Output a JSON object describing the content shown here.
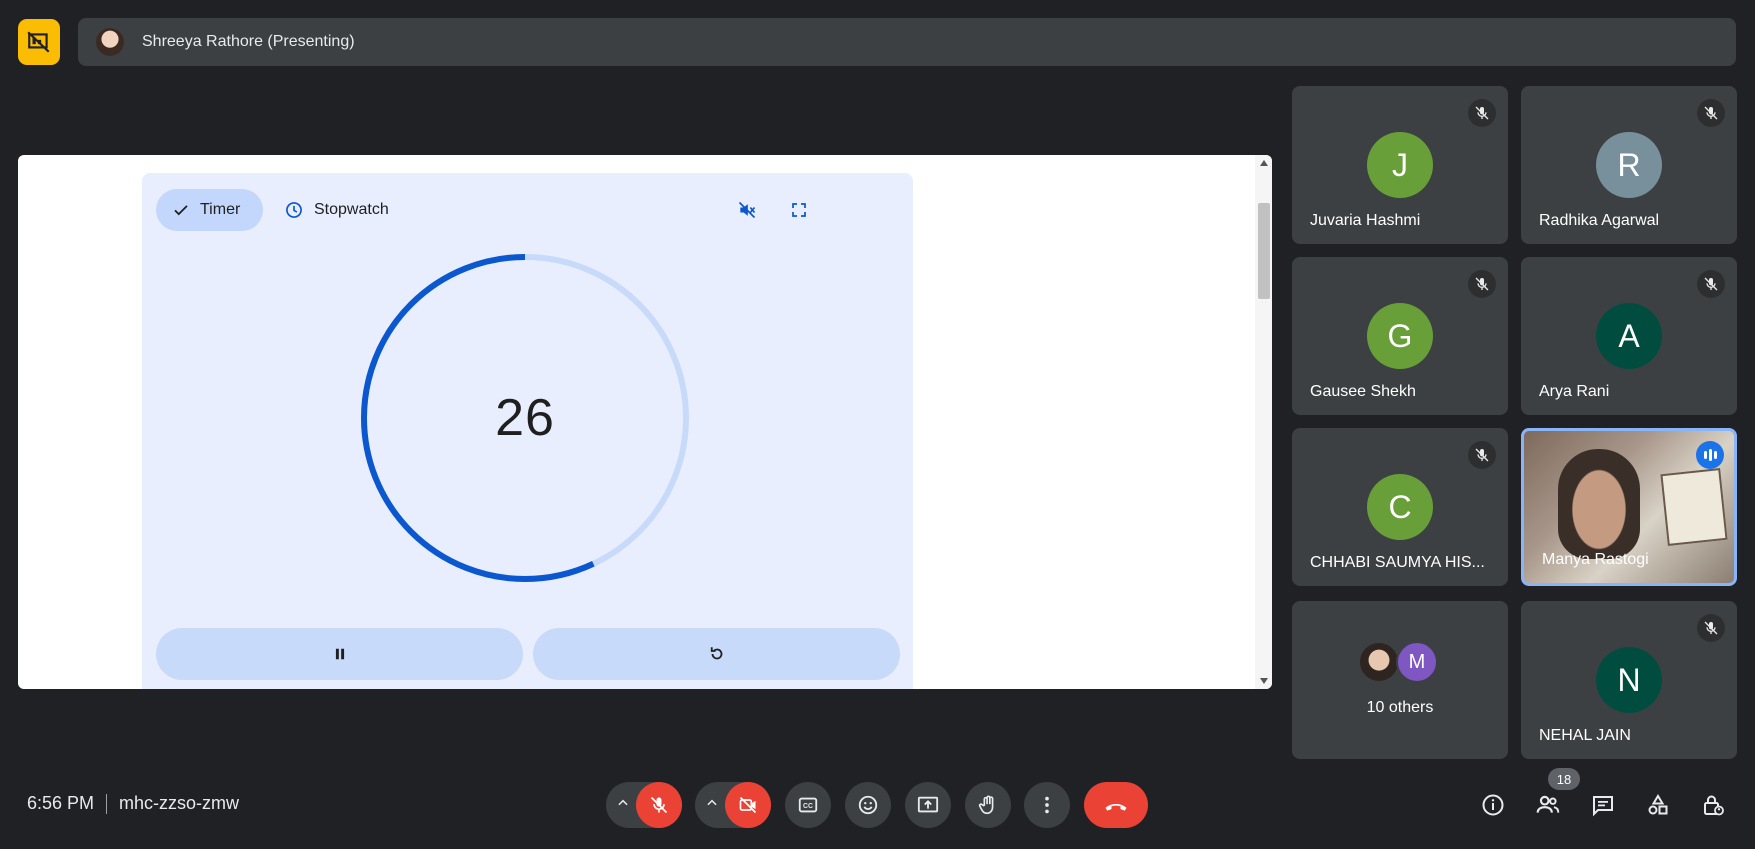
{
  "presenting_bar": {
    "presenter_label": "Shreeya Rathore (Presenting)",
    "badge_icon": "present-off-icon",
    "accent": "#fbbc04"
  },
  "timer_app": {
    "tabs": [
      {
        "label": "Timer",
        "selected": true,
        "icon": "check-icon"
      },
      {
        "label": "Stopwatch",
        "selected": false,
        "icon": "clock-icon"
      }
    ],
    "sound_icon": "volume-off-icon",
    "fullscreen_icon": "fullscreen-icon",
    "remaining": "26",
    "ring_progress": 0.43,
    "ring_color": "#0b57d0",
    "pause_icon": "pause-icon",
    "reset_icon": "reset-icon"
  },
  "participants": [
    {
      "name": "Juvaria Hashmi",
      "initial": "J",
      "color": "#689f38",
      "muted": true
    },
    {
      "name": "Radhika Agarwal",
      "initial": "R",
      "color": "#78909c",
      "muted": true
    },
    {
      "name": "Gausee Shekh",
      "initial": "G",
      "color": "#689f38",
      "muted": true
    },
    {
      "name": "Arya Rani",
      "initial": "A",
      "color": "#004d40",
      "muted": true
    },
    {
      "name": "CHHABI SAUMYA HIS...",
      "initial": "C",
      "color": "#689f38",
      "muted": true
    },
    {
      "name": "Manya Rastogi",
      "video": true,
      "speaking": true
    },
    {
      "others_label": "10 others",
      "others_initial": "M",
      "others_color": "#7e57c2"
    },
    {
      "name": "NEHAL JAIN",
      "initial": "N",
      "color": "#004d40",
      "muted": true
    }
  ],
  "bottom_bar": {
    "time": "6:56 PM",
    "meeting_code": "mhc-zzso-zmw",
    "controls": [
      "mic-off-icon",
      "camera-off-icon",
      "captions-icon",
      "emoji-icon",
      "present-icon",
      "raise-hand-icon",
      "more-icon",
      "end-call-icon"
    ],
    "people_count": "18",
    "right_icons": [
      "info-icon",
      "people-icon",
      "chat-icon",
      "activities-icon",
      "host-controls-icon"
    ]
  }
}
